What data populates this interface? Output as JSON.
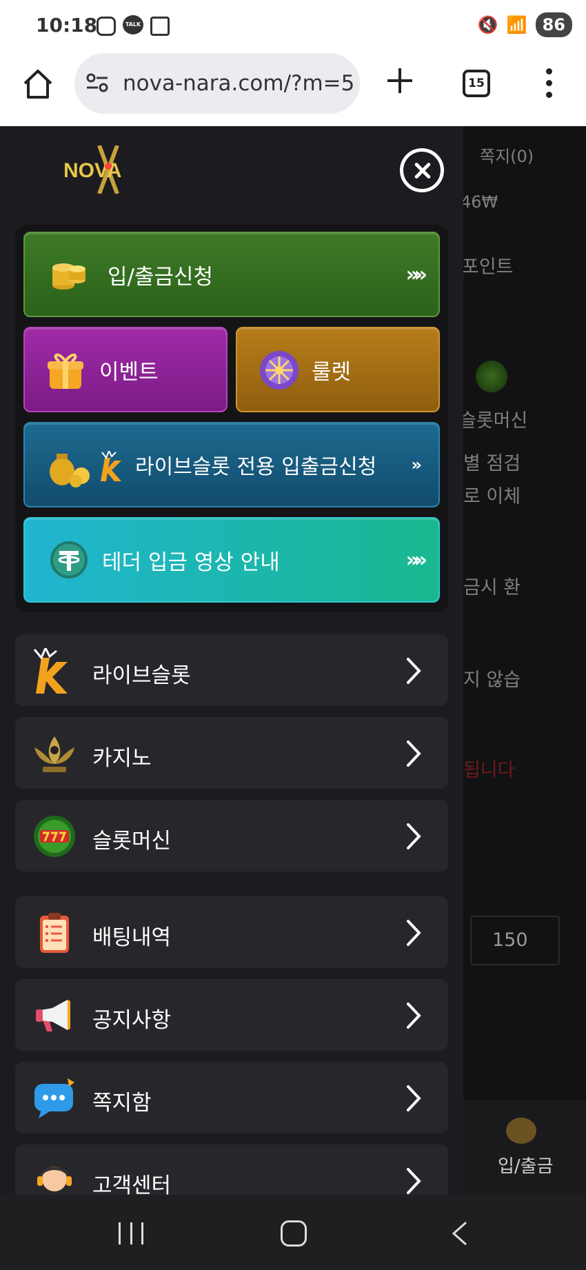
{
  "status_bar": {
    "time": "10:18",
    "battery": "86",
    "talk_badge": "TALK"
  },
  "browser": {
    "url": "nova-nara.com/?m=5",
    "tab_count": "15"
  },
  "drawer": {
    "logo_text": "NOVA",
    "buttons": {
      "deposit": "입/출금신청",
      "event": "이벤트",
      "roulette": "룰렛",
      "live_slot_deposit": "라이브슬롯 전용 입출금신청",
      "tether_guide": "테더 입금 영상 안내",
      "arrow": "»"
    },
    "menu_items": [
      {
        "label": "라이브슬롯",
        "icon": "k-logo-icon"
      },
      {
        "label": "카지노",
        "icon": "kslot-lotus-icon"
      },
      {
        "label": "슬롯머신",
        "icon": "777-slots-icon"
      },
      {
        "label": "배팅내역",
        "icon": "clipboard-icon"
      },
      {
        "label": "공지사항",
        "icon": "megaphone-icon"
      },
      {
        "label": "쪽지함",
        "icon": "chat-bubble-icon"
      },
      {
        "label": "고객센터",
        "icon": "headset-agent-icon"
      }
    ]
  },
  "background_page": {
    "messages": "쪽지(0)",
    "balance": "46₩",
    "points": "포인트",
    "slot_machine": "슬롯머신",
    "line1": "별 점검",
    "line2": "로 이체",
    "line3": "금시 환",
    "line4": "지 않습",
    "line5": "됩니다",
    "input_value": "150",
    "bottom_tab": "입/출금"
  },
  "colors": {
    "deposit_green": "#2f6a1e",
    "event_purple": "#8a2196",
    "roulette_orange": "#a06c12",
    "live_blue": "#175a80",
    "tether_teal": "#1cb6b0"
  }
}
